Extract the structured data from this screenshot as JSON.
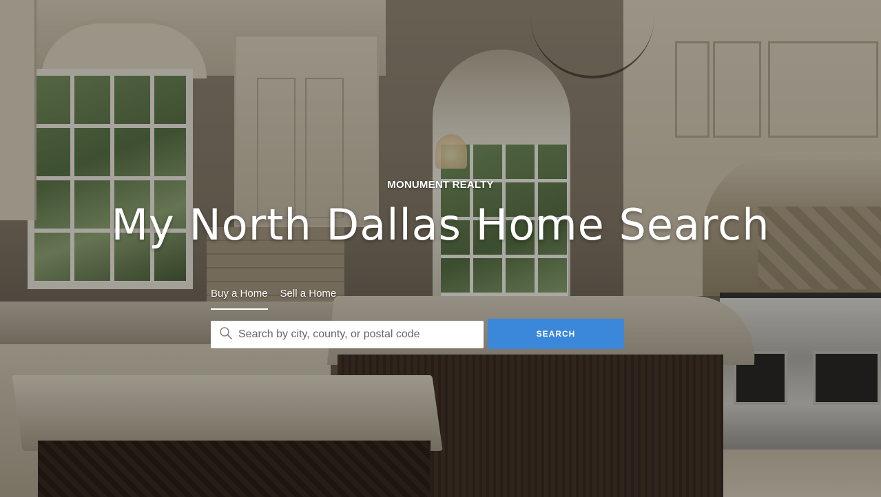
{
  "hero": {
    "brand": "MONUMENT REALTY",
    "headline": "My North Dallas Home Search"
  },
  "tabs": [
    {
      "label": "Buy a Home",
      "active": true
    },
    {
      "label": "Sell a Home",
      "active": false
    }
  ],
  "search": {
    "placeholder": "Search by city, county, or postal code",
    "value": "",
    "button_label": "SEARCH",
    "icon": "search-icon"
  },
  "colors": {
    "accent": "#3b87d9",
    "text": "#ffffff"
  }
}
